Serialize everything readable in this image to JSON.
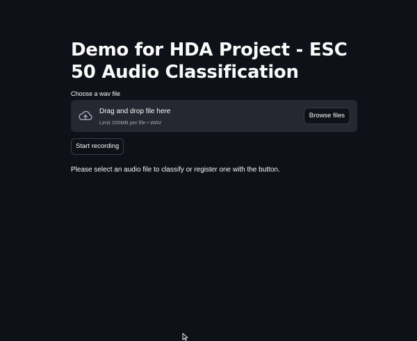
{
  "page": {
    "title": "Demo for HDA Project - ESC 50 Audio Classification"
  },
  "uploader": {
    "label": "Choose a wav file",
    "drag_text": "Drag and drop file here",
    "limit_text": "Limit 200MB per file • WAV",
    "browse_label": "Browse files",
    "icon": "cloud-upload-icon"
  },
  "recording": {
    "button_label": "Start recording"
  },
  "status": {
    "message": "Please select an audio file to classify or register one with the button."
  },
  "colors": {
    "background": "#0e1117",
    "dropzone": "#262730",
    "text": "#fafafa",
    "muted_text": "#a3a8b8"
  }
}
